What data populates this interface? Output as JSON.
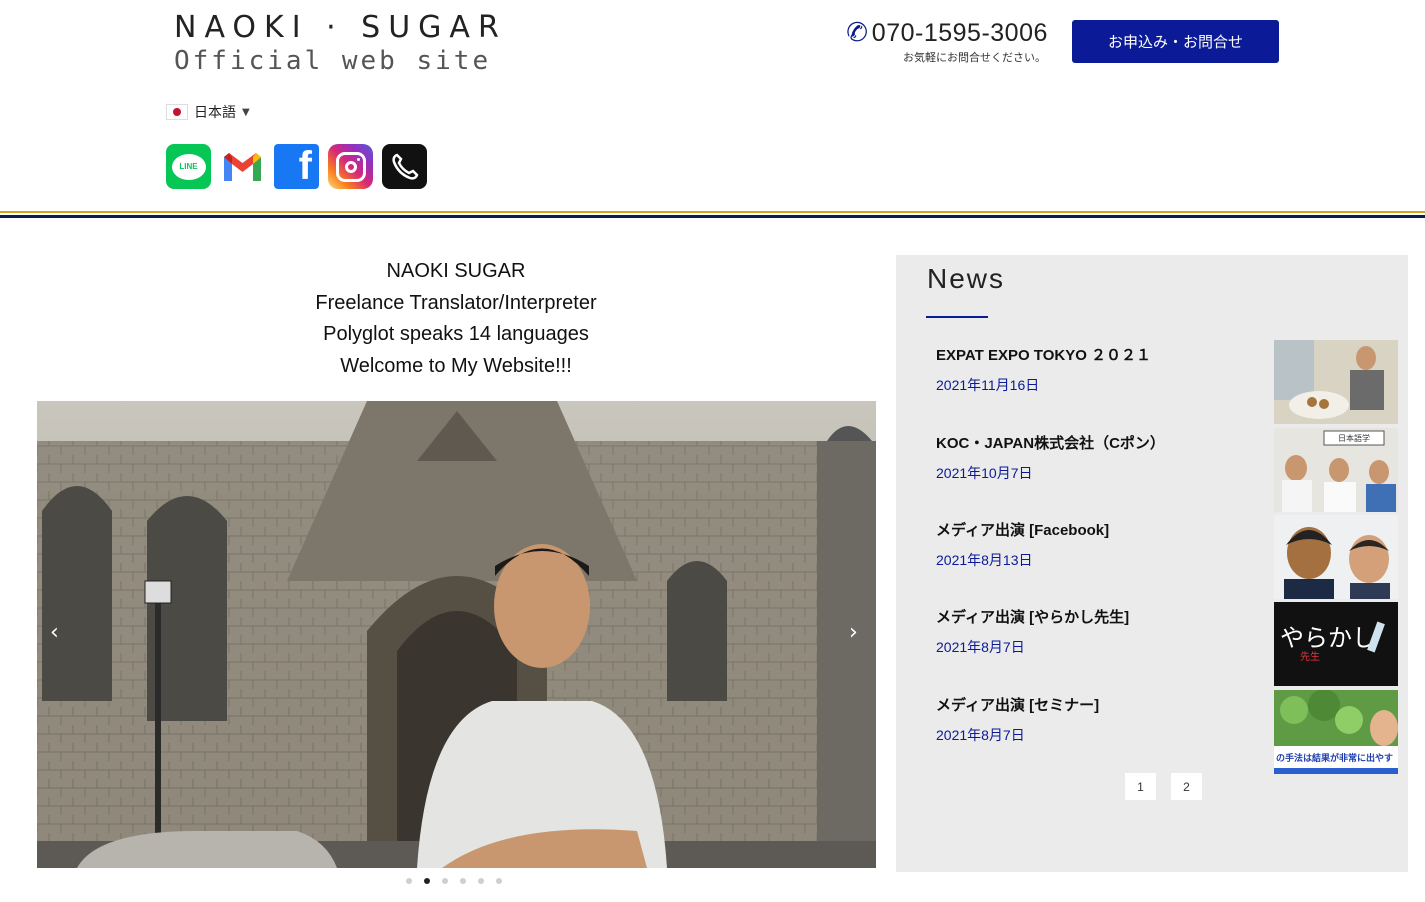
{
  "header": {
    "logo_line1": "NAOKI · SUGAR",
    "logo_line2": "Official web site",
    "language": "日本語",
    "phone": "070-1595-3006",
    "phone_note": "お気軽にお問合せください。",
    "cta_label": "お申込み・お問合せ"
  },
  "socials": [
    {
      "name": "line-icon",
      "label": "LINE"
    },
    {
      "name": "gmail-icon"
    },
    {
      "name": "facebook-icon",
      "label": "f"
    },
    {
      "name": "instagram-icon"
    },
    {
      "name": "phone-icon"
    }
  ],
  "intro": {
    "line1": "NAOKI SUGAR",
    "line2": "Freelance Translator/Interpreter",
    "line3": "Polyglot speaks 14 languages",
    "line4": "Welcome to My Website!!!"
  },
  "slider": {
    "prev": "‹",
    "next": "›",
    "dot_count": 6,
    "active_dot": 1
  },
  "news": {
    "title": "News",
    "items": [
      {
        "title": "EXPAT EXPO TOKYO ２０２１",
        "date": "2021年11月16日"
      },
      {
        "title": "KOC・JAPAN株式会社（Cポン）",
        "date": "2021年10月7日"
      },
      {
        "title": "メディア出演 [Facebook]",
        "date": "2021年8月13日"
      },
      {
        "title": "メディア出演 [やらかし先生]",
        "date": "2021年8月7日"
      },
      {
        "title": "メディア出演 [セミナー]",
        "date": "2021年8月7日"
      }
    ],
    "thumb_texts": {
      "t2": "日本語学",
      "t4": "やらかし",
      "t4b": "先生",
      "t5": "の手法は結果が非常に出やす"
    },
    "pages": [
      "1",
      "2"
    ]
  },
  "colors": {
    "navy": "#0b1a96",
    "gold_rule": "#d7a21e",
    "news_bg": "#ebebeb"
  }
}
